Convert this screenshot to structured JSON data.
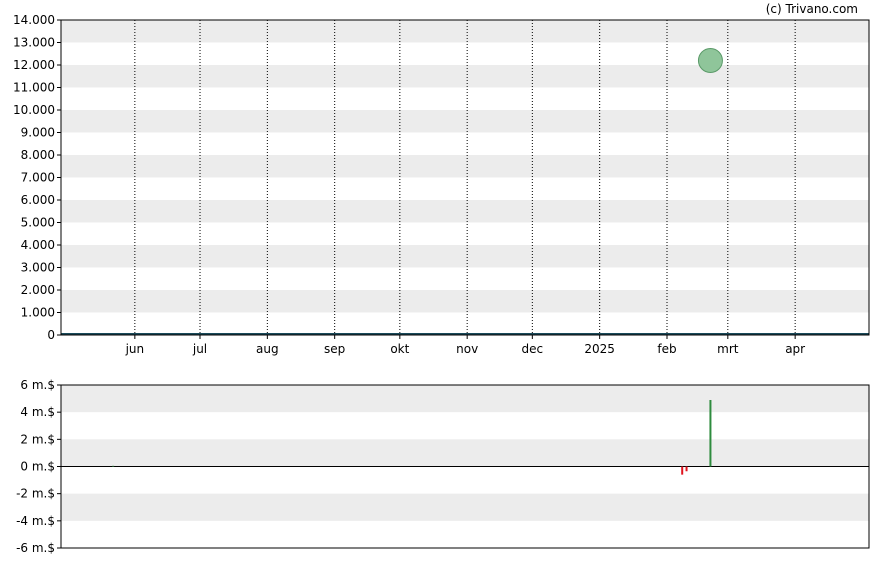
{
  "credit": "(c) Trivano.com",
  "colors": {
    "band": "#ececec",
    "grid": "#000000",
    "bubble_fill": "#8fc59a",
    "bubble_stroke": "#5a9a68",
    "bar_positive": "#2e8b3e",
    "bar_negative": "#e0141e",
    "baseline": "#1a4a5a"
  },
  "chart_data": [
    {
      "type": "scatter",
      "ylim": [
        0,
        14000
      ],
      "y_ticks": [
        "0",
        "1.000",
        "2.000",
        "3.000",
        "4.000",
        "5.000",
        "6.000",
        "7.000",
        "8.000",
        "9.000",
        "10.000",
        "11.000",
        "12.000",
        "13.000",
        "14.000"
      ],
      "x_ticks": [
        "jun",
        "jul",
        "aug",
        "sep",
        "okt",
        "nov",
        "dec",
        "2025",
        "feb",
        "mrt",
        "apr"
      ],
      "xlim": [
        "2024-04-28",
        "2025-05-05"
      ],
      "x_tick_dates": [
        "2024-06-01",
        "2024-07-01",
        "2024-08-01",
        "2024-09-01",
        "2024-10-01",
        "2024-11-01",
        "2024-12-01",
        "2025-01-01",
        "2025-02-01",
        "2025-03-01",
        "2025-04-01"
      ],
      "grid": true,
      "points": [
        {
          "x": "2025-02-21",
          "y": 12200
        }
      ]
    },
    {
      "type": "bar",
      "ylim": [
        -6,
        6
      ],
      "y_ticks": [
        "6 m.$",
        "4 m.$",
        "2 m.$",
        "0 m.$",
        "-2 m.$",
        "-4 m.$",
        "-6 m.$"
      ],
      "xlim": [
        "2024-04-28",
        "2025-05-05"
      ],
      "grid": true,
      "bars": [
        {
          "x": "2024-05-22",
          "value": 0.05
        },
        {
          "x": "2025-02-08",
          "value": -0.6
        },
        {
          "x": "2025-02-10",
          "value": -0.35
        },
        {
          "x": "2025-02-21",
          "value": 4.9
        }
      ]
    }
  ]
}
